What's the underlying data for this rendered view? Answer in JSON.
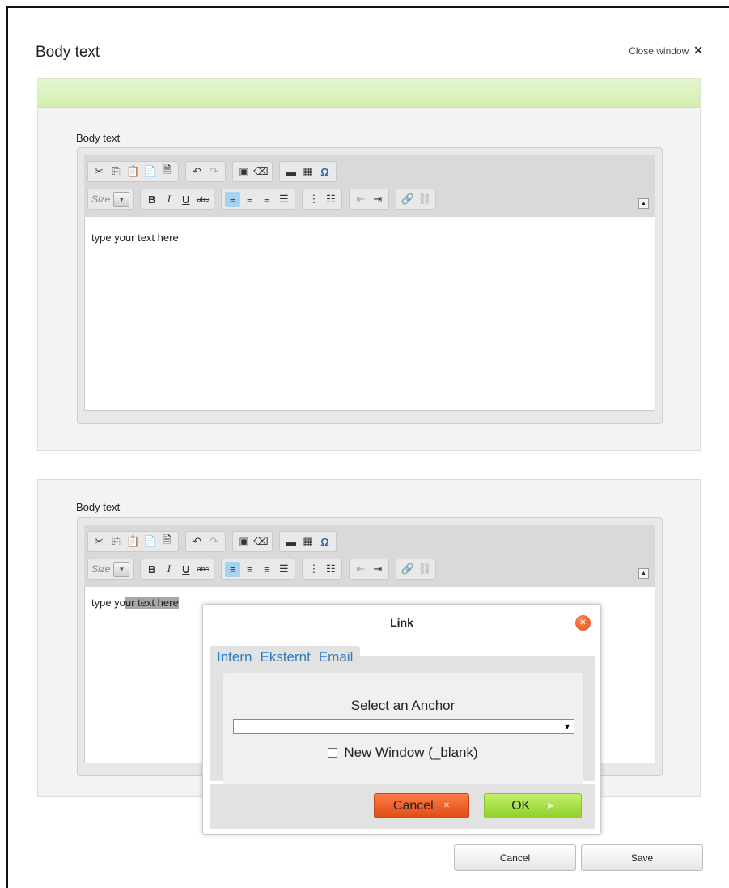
{
  "header": {
    "title": "Body text",
    "close_label": "Close window"
  },
  "editors": [
    {
      "label": "Body text",
      "content": "type your text here"
    },
    {
      "label": "Body text",
      "content_before": "type yo",
      "content_selected": "ur text here"
    }
  ],
  "toolbar": {
    "size_label": "Size",
    "bold": "B",
    "italic": "I",
    "underline": "U",
    "strike": "abc"
  },
  "dialog": {
    "title": "Link",
    "tabs": [
      "Intern",
      "Eksternt",
      "Email"
    ],
    "anchor_label": "Select an Anchor",
    "anchor_value": "",
    "new_window_label": "New Window (_blank)",
    "cancel_label": "Cancel",
    "ok_label": "OK"
  },
  "footer": {
    "cancel_label": "Cancel",
    "save_label": "Save"
  },
  "colors": {
    "green_bar": "#d3eeb0",
    "cancel_btn": "#e04d16",
    "ok_btn": "#8fd228",
    "tab_link": "#2f7bc0"
  }
}
